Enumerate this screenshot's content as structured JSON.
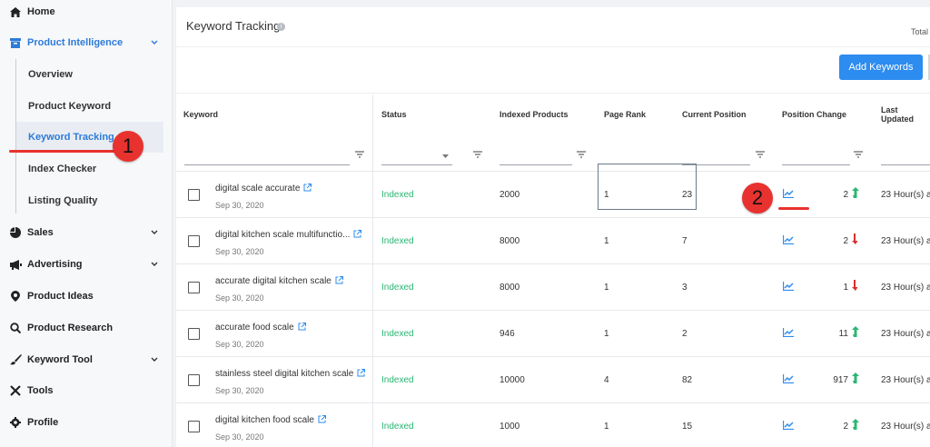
{
  "sidebar": {
    "home": "Home",
    "product_intelligence": "Product Intelligence",
    "sub_items": [
      "Overview",
      "Product Keyword",
      "Keyword Tracking",
      "Index Checker",
      "Listing Quality"
    ],
    "sales": "Sales",
    "advertising": "Advertising",
    "product_ideas": "Product Ideas",
    "product_research": "Product Research",
    "keyword_tool": "Keyword Tool",
    "tools": "Tools",
    "profile": "Profile"
  },
  "header": {
    "title": "Keyword Tracking",
    "total_label": "Total"
  },
  "toolbar": {
    "add_keywords": "Add Keywords"
  },
  "table": {
    "columns": [
      "Keyword",
      "Status",
      "Indexed Products",
      "Page Rank",
      "Current Position",
      "Position Change",
      "Last Updated"
    ],
    "rows": [
      {
        "keyword": "digital scale accurate",
        "date": "Sep 30, 2020",
        "status": "Indexed",
        "indexed": "2000",
        "rank": "1",
        "current": "23",
        "change": "2",
        "dir": "up",
        "updated": "23 Hour(s) a"
      },
      {
        "keyword": "digital kitchen scale multifunctio...",
        "date": "Sep 30, 2020",
        "status": "Indexed",
        "indexed": "8000",
        "rank": "1",
        "current": "7",
        "change": "2",
        "dir": "down",
        "updated": "23 Hour(s) a"
      },
      {
        "keyword": "accurate digital kitchen scale",
        "date": "Sep 30, 2020",
        "status": "Indexed",
        "indexed": "8000",
        "rank": "1",
        "current": "3",
        "change": "1",
        "dir": "down",
        "updated": "23 Hour(s) a"
      },
      {
        "keyword": "accurate food scale",
        "date": "Sep 30, 2020",
        "status": "Indexed",
        "indexed": "946",
        "rank": "1",
        "current": "2",
        "change": "11",
        "dir": "up",
        "updated": "23 Hour(s) a"
      },
      {
        "keyword": "stainless steel digital kitchen scale",
        "date": "Sep 30, 2020",
        "status": "Indexed",
        "indexed": "10000",
        "rank": "4",
        "current": "82",
        "change": "917",
        "dir": "up",
        "updated": "23 Hour(s) a"
      },
      {
        "keyword": "digital kitchen food scale",
        "date": "Sep 30, 2020",
        "status": "Indexed",
        "indexed": "1000",
        "rank": "1",
        "current": "15",
        "change": "2",
        "dir": "up",
        "updated": "23 Hour(s) a"
      }
    ]
  },
  "annotations": {
    "marker_1": "1",
    "marker_2": "2"
  },
  "colors": {
    "accent": "#2d7bd8",
    "button": "#2d8cf0",
    "indexed_green": "#2bb673",
    "down_red": "#d9302c",
    "annotation_red": "#e8322f"
  }
}
